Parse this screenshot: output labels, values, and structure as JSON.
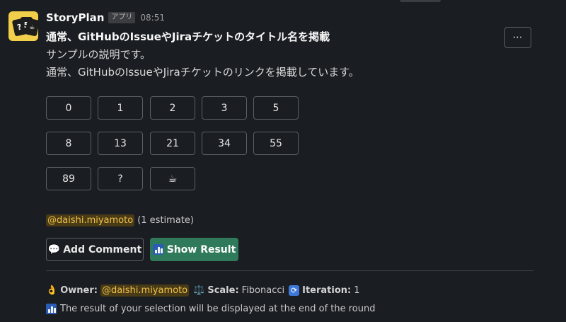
{
  "message": {
    "app_name": "StoryPlan",
    "app_badge": "アプリ",
    "time": "08:51",
    "more_label": "⋯",
    "title": "通常、GitHubのIssueやJiraチケットのタイトル名を掲載",
    "description_lines": [
      "サンプルの説明です。",
      "通常、GitHubのIssueやJiraチケットのリンクを掲載しています。"
    ]
  },
  "avatar": {
    "cards": [
      "?",
      "5",
      "☕"
    ]
  },
  "vote_buttons": [
    "0",
    "1",
    "2",
    "3",
    "5",
    "8",
    "13",
    "21",
    "34",
    "55",
    "89",
    "?",
    "☕"
  ],
  "voters": {
    "mention": "@daishi.miyamoto",
    "estimate": "(1 estimate)"
  },
  "actions": {
    "add_comment_icon": "💬",
    "add_comment_label": "Add Comment",
    "show_result_label": "Show Result"
  },
  "context": {
    "owner_icon": "👌",
    "owner_label": "Owner:",
    "owner_mention": "@daishi.miyamoto",
    "scale_icon": "⚖️",
    "scale_label": "Scale:",
    "scale_value": "Fibonacci",
    "iteration_label": "Iteration:",
    "iteration_value": "1",
    "result_note": "The result of your selection will be displayed at the end of the round"
  },
  "colors": {
    "background": "#1a1d21",
    "mention_bg": "#4a3b17",
    "mention_text": "#f1c24b",
    "primary_button": "#2f7a5a",
    "avatar_bg": "#f2cf4a"
  }
}
